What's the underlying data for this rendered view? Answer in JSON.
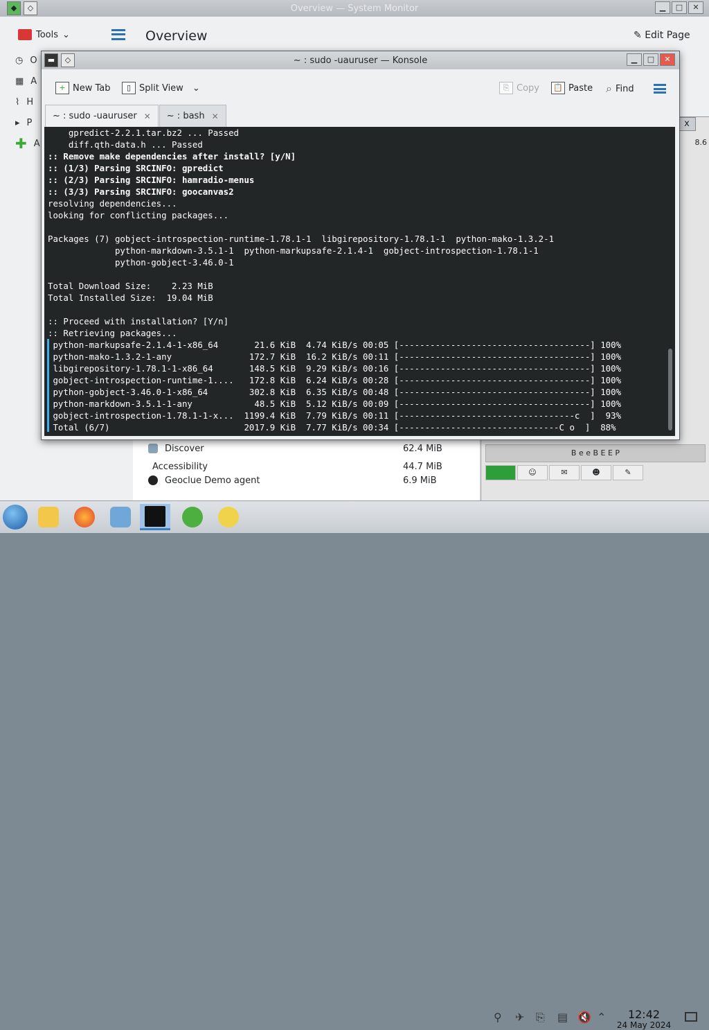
{
  "sysmon": {
    "title": "Overview — System Monitor",
    "tools_label": "Tools",
    "page_title": "Overview",
    "edit_page": "Edit Page",
    "sidebar_initials": [
      "O",
      "A",
      "H",
      "P",
      "A"
    ],
    "processes": [
      {
        "name": "Discover",
        "mem": "62.4 MiB"
      },
      {
        "name": "Accessibility",
        "mem": "44.7 MiB"
      },
      {
        "name": "Geoclue Demo agent",
        "mem": "6.9 MiB"
      }
    ]
  },
  "widget": {
    "version_fragment": "8.6",
    "beep_text": "B e e B E E P",
    "close": "x"
  },
  "konsole": {
    "title": "~ : sudo -uauruser — Konsole",
    "toolbar": {
      "new_tab": "New Tab",
      "split_view": "Split View",
      "copy": "Copy",
      "paste": "Paste",
      "find": "Find"
    },
    "tabs": [
      {
        "label": "~ : sudo -uauruser",
        "active": true
      },
      {
        "label": "~ : bash",
        "active": false
      }
    ],
    "lines": [
      {
        "text": "    gpredict-2.2.1.tar.bz2 ... Passed",
        "bold": false
      },
      {
        "text": "    diff.qth-data.h ... Passed",
        "bold": false
      },
      {
        "text": ":: Remove make dependencies after install? [y/N]",
        "bold": true
      },
      {
        "text": ":: (1/3) Parsing SRCINFO: gpredict",
        "bold": true
      },
      {
        "text": ":: (2/3) Parsing SRCINFO: hamradio-menus",
        "bold": true
      },
      {
        "text": ":: (3/3) Parsing SRCINFO: goocanvas2",
        "bold": true
      },
      {
        "text": "resolving dependencies...",
        "bold": false
      },
      {
        "text": "looking for conflicting packages...",
        "bold": false
      },
      {
        "text": "",
        "bold": false
      },
      {
        "text": "Packages (7) gobject-introspection-runtime-1.78.1-1  libgirepository-1.78.1-1  python-mako-1.3.2-1",
        "bold": false
      },
      {
        "text": "             python-markdown-3.5.1-1  python-markupsafe-2.1.4-1  gobject-introspection-1.78.1-1",
        "bold": false
      },
      {
        "text": "             python-gobject-3.46.0-1",
        "bold": false
      },
      {
        "text": "",
        "bold": false
      },
      {
        "text": "Total Download Size:    2.23 MiB",
        "bold": false
      },
      {
        "text": "Total Installed Size:  19.04 MiB",
        "bold": false
      },
      {
        "text": "",
        "bold": false
      },
      {
        "text": ":: Proceed with installation? [Y/n]",
        "bold": false
      },
      {
        "text": ":: Retrieving packages...",
        "bold": false
      },
      {
        "text": " python-markupsafe-2.1.4-1-x86_64       21.6 KiB  4.74 KiB/s 00:05 [-------------------------------------] 100%",
        "bold": false
      },
      {
        "text": " python-mako-1.3.2-1-any               172.7 KiB  16.2 KiB/s 00:11 [-------------------------------------] 100%",
        "bold": false
      },
      {
        "text": " libgirepository-1.78.1-1-x86_64       148.5 KiB  9.29 KiB/s 00:16 [-------------------------------------] 100%",
        "bold": false
      },
      {
        "text": " gobject-introspection-runtime-1....   172.8 KiB  6.24 KiB/s 00:28 [-------------------------------------] 100%",
        "bold": false
      },
      {
        "text": " python-gobject-3.46.0-1-x86_64        302.8 KiB  6.35 KiB/s 00:48 [-------------------------------------] 100%",
        "bold": false
      },
      {
        "text": " python-markdown-3.5.1-1-any            48.5 KiB  5.12 KiB/s 00:09 [-------------------------------------] 100%",
        "bold": false
      },
      {
        "text": " gobject-introspection-1.78.1-1-x...  1199.4 KiB  7.79 KiB/s 00:11 [----------------------------------c  ]  93%",
        "bold": false
      },
      {
        "text": " Total (6/7)                          2017.9 KiB  7.77 KiB/s 00:34 [-------------------------------C o  ]  88%",
        "bold": false
      }
    ]
  },
  "taskbar": {
    "clock_time": "12:42",
    "clock_date": "24 May 2024",
    "apps": [
      "start-menu",
      "file-manager",
      "firefox",
      "system-monitor",
      "konsole",
      "tools",
      "bee"
    ]
  },
  "colors": {
    "terminal_bg": "#232627",
    "accent": "#3daee9",
    "progress_char": "#fdbc4b"
  }
}
